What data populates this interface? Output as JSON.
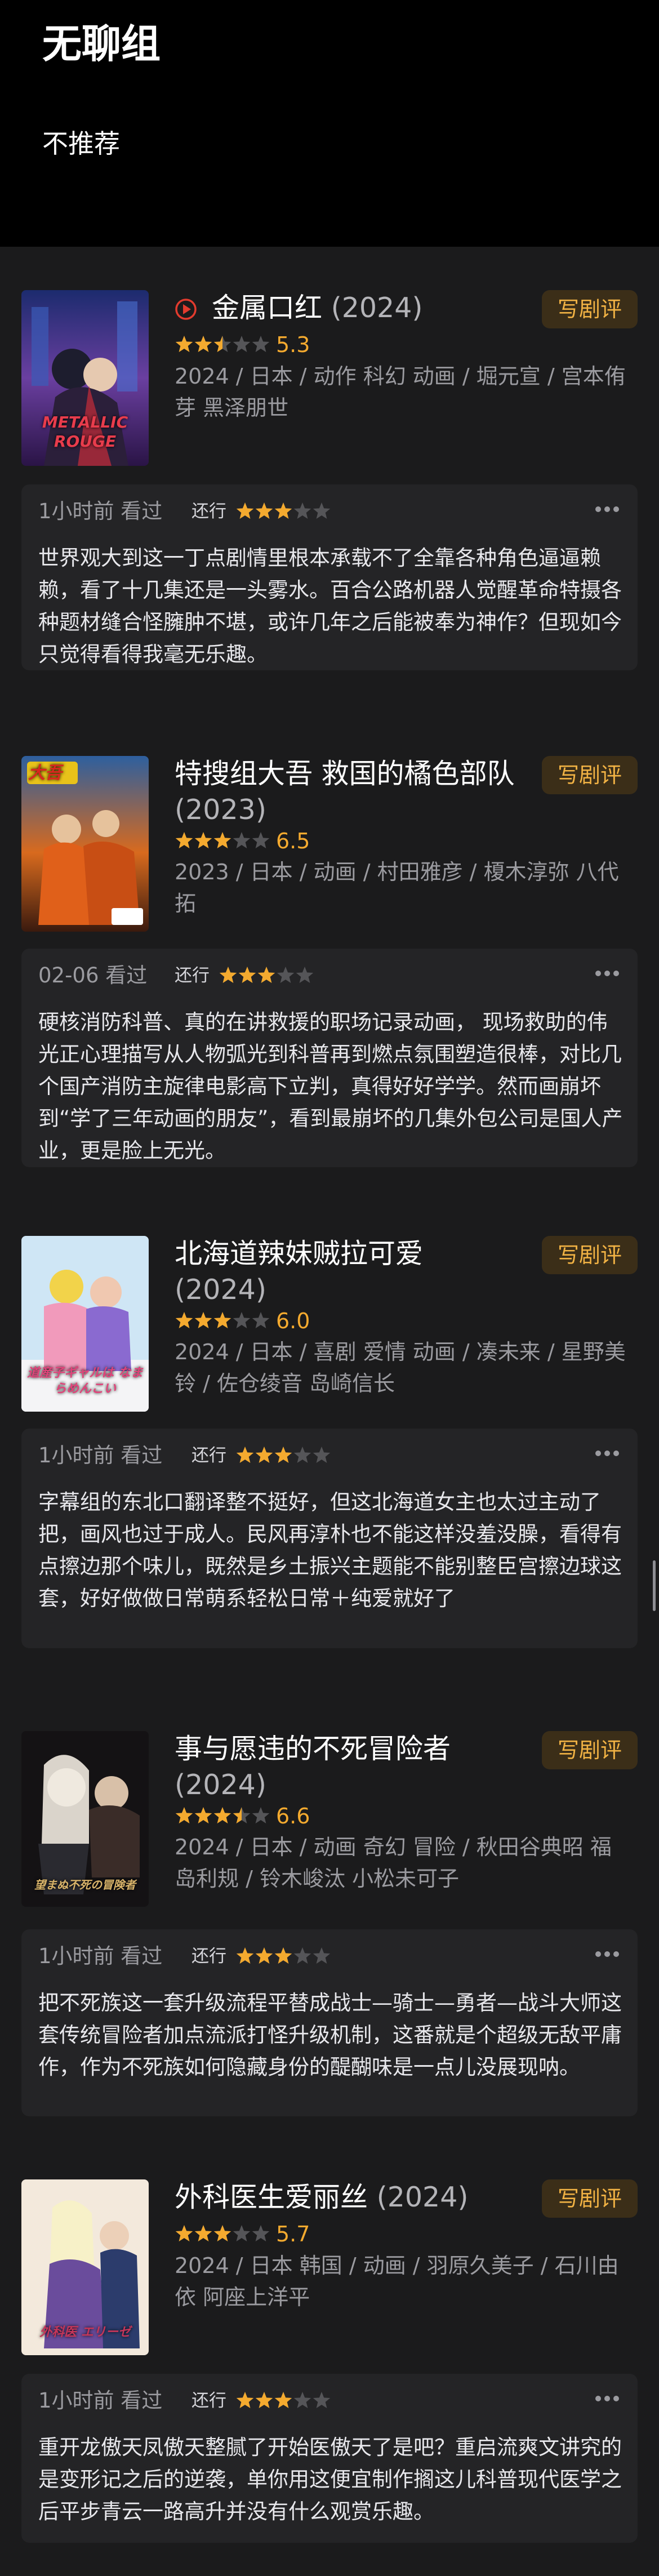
{
  "header": {
    "title": "无聊组",
    "subtitle": "不推荐"
  },
  "colors": {
    "accent": "#f4aa2f",
    "button_text": "#f1b244",
    "play_icon": "#e23b2e",
    "star_off": "#555558"
  },
  "write_review_label": "写剧评",
  "entries": [
    {
      "title": "金属口红",
      "year": "(2024)",
      "has_play_icon": true,
      "stars": 2.5,
      "score": "5.3",
      "meta": "2024 / 日本 / 动作 科幻 动画 / 堀元宣 / 宫本侑芽 黑泽朋世",
      "poster_text": "METALLIC ROUGE",
      "time": "1小时前 看过",
      "status": "还行",
      "my_stars": 3,
      "review": "世界观大到这一丁点剧情里根本承载不了全靠各种角色逼逼赖赖，看了十几集还是一头雾水。百合公路机器人觉醒革命特摄各种题材缝合怪臃肿不堪，或许几年之后能被奉为神作？但现如今只觉得看得我毫无乐趣。"
    },
    {
      "title": "特搜组大吾 救国的橘色部队",
      "year": "(2023)",
      "has_play_icon": false,
      "stars": 3,
      "score": "6.5",
      "meta": "2023 / 日本 / 动画 / 村田雅彦 / 榎木淳弥 八代拓",
      "poster_text": "大吾",
      "time": "02-06 看过",
      "status": "还行",
      "my_stars": 3,
      "review": "硬核消防科普、真的在讲救援的职场记录动画， 现场救助的伟光正心理描写从人物弧光到科普再到燃点氛围塑造很棒，对比几个国产消防主旋律电影高下立判，真得好好学学。然而画崩坏到“学了三年动画的朋友”，看到最崩坏的几集外包公司是国人产业，更是脸上无光。"
    },
    {
      "title": "北海道辣妹贼拉可爱",
      "year": "(2024)",
      "has_play_icon": false,
      "stars": 3,
      "score": "6.0",
      "meta": "2024 / 日本 / 喜剧 爱情 动画 / 凑未来 / 星野美铃 / 佐仓绫音 岛崎信长",
      "poster_text": "道産子ギャルは なまらめんこい",
      "time": "1小时前 看过",
      "status": "还行",
      "my_stars": 3,
      "review": "字幕组的东北口翻译整不挺好，但这北海道女主也太过主动了把，画风也过于成人。民风再淳朴也不能这样没羞没臊，看得有点擦边那个味儿，既然是乡土振兴主题能不能别整臣宫擦边球这套，好好做做日常萌系轻松日常＋纯爱就好了"
    },
    {
      "title": "事与愿违的不死冒险者",
      "year": "(2024)",
      "has_play_icon": false,
      "stars": 3.5,
      "score": "6.6",
      "meta": "2024 / 日本 / 动画 奇幻 冒险 / 秋田谷典昭 福岛利规 / 铃木峻汰 小松未可子",
      "poster_text": "望まぬ不死の冒険者",
      "time": "1小时前 看过",
      "status": "还行",
      "my_stars": 3,
      "review": "把不死族这一套升级流程平替成战士—骑士—勇者—战斗大师这套传统冒险者加点流派打怪升级机制，这番就是个超级无敌平庸作，作为不死族如何隐藏身份的醍醐味是一点儿没展现呐。"
    },
    {
      "title": "外科医生爱丽丝",
      "year": "(2024)",
      "has_play_icon": false,
      "stars": 3,
      "score": "5.7",
      "meta": "2024 / 日本 韩国 / 动画 / 羽原久美子 / 石川由依 阿座上洋平",
      "poster_text": "外科医 エリーゼ",
      "time": "1小时前 看过",
      "status": "还行",
      "my_stars": 3,
      "review": "重开龙傲天凤傲天整腻了开始医傲天了是吧？重启流爽文讲究的是变形记之后的逆袭，单你用这便宜制作搁这儿科普现代医学之后平步青云一路高升并没有什么观赏乐趣。"
    }
  ]
}
